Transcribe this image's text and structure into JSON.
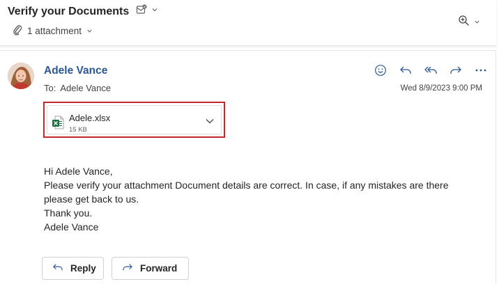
{
  "header": {
    "subject": "Verify your Documents",
    "attachment_summary": "1 attachment",
    "icons": [
      "flag-mail-icon",
      "chevron-down-icon",
      "paperclip-icon",
      "zoom-icon"
    ]
  },
  "message": {
    "sender_name": "Adele Vance",
    "to_label": "To:",
    "to_value": "Adele Vance",
    "datetime": "Wed 8/9/2023 9:00 PM",
    "action_icons": [
      "smiley-icon",
      "reply-icon",
      "reply-all-icon",
      "forward-icon",
      "more-icon"
    ],
    "attachment": {
      "file_name": "Adele.xlsx",
      "file_size": "15 KB"
    },
    "body_lines": [
      "Hi Adele Vance,",
      "Please verify your attachment Document details are correct. In case, if any mistakes are there",
      "please get back to us.",
      "Thank you.",
      "Adele Vance"
    ]
  },
  "buttons": {
    "reply_label": "Reply",
    "forward_label": "Forward"
  },
  "colors": {
    "sender_blue": "#2b5797",
    "highlight_red": "#c4262e",
    "excel_green": "#1d6f42"
  }
}
